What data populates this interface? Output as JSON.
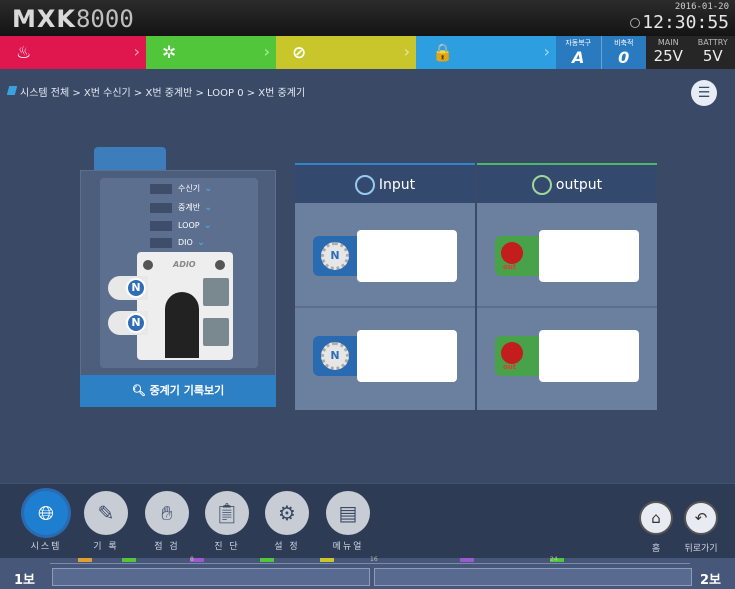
{
  "header": {
    "logo_text": "MXK",
    "logo_num": "8000",
    "date": "2016-01-20",
    "time": "12:30:55"
  },
  "status": {
    "fire_icon": "fire-icon",
    "supervisory_icon": "gear-icon",
    "trouble_icon": "prohibit-icon",
    "security_icon": "lock-icon",
    "auto_restore_label": "자동복구",
    "auto_restore_value": "A",
    "accumulate_label": "비축적",
    "accumulate_value": "0",
    "main_label": "MAIN",
    "main_value": "25V",
    "battery_label": "BATTRY",
    "battery_value": "5V",
    "colors": {
      "fire": "#e0164f",
      "supervisory": "#52c63a",
      "trouble": "#c9c62c",
      "security": "#2d9fe0"
    }
  },
  "breadcrumb": {
    "text": "시스템 전체 > X번 수신기 > X번 중계반 > LOOP 0 > X번 중계기"
  },
  "selector": {
    "rows": [
      "수신기",
      "중계반",
      "LOOP",
      "DIO"
    ],
    "device_brand": "ADIO",
    "badge": "N",
    "history_button": "중계기 기록보기"
  },
  "io": {
    "input_label": "Input",
    "output_label": "output",
    "input_badge": "N",
    "output_badge": "out"
  },
  "nav": {
    "items": [
      "시스템",
      "기 록",
      "점 검",
      "진 단",
      "설 정",
      "메뉴얼"
    ],
    "home": "홈",
    "back": "뒤로가기"
  },
  "timeline": {
    "left": "1보",
    "right": "2보",
    "ticks": [
      "8",
      "16",
      "24"
    ]
  }
}
